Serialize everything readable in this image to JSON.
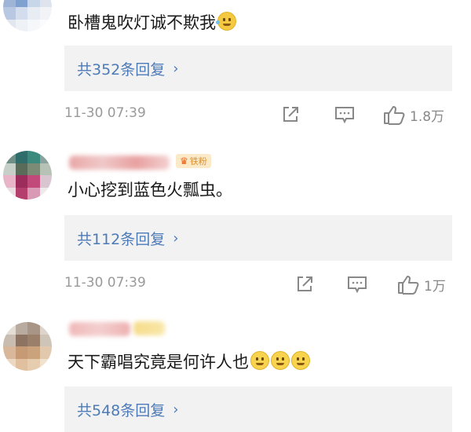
{
  "comments": [
    {
      "text": "卧槽鬼吹灯诚不欺我",
      "replies": "共352条回复",
      "time": "11-30 07:39",
      "likes": "1.8万"
    },
    {
      "badge": "铁粉",
      "text": "小心挖到蓝色火瓢虫。",
      "replies": "共112条回复",
      "time": "11-30 07:39",
      "likes": "1万"
    },
    {
      "text": "天下霸唱究竟是何许人也",
      "replies": "共548条回复"
    }
  ],
  "icons": {
    "share": "share-icon",
    "comment": "comment-icon",
    "like": "thumbs-up-icon",
    "reply_chevron": "chevron-right-icon"
  },
  "colors": {
    "link": "#4d7bb7",
    "reply_bg": "#f2f2f2",
    "meta": "#999999",
    "badge_bg": "#fbe9c7",
    "badge_text": "#e0902a"
  }
}
